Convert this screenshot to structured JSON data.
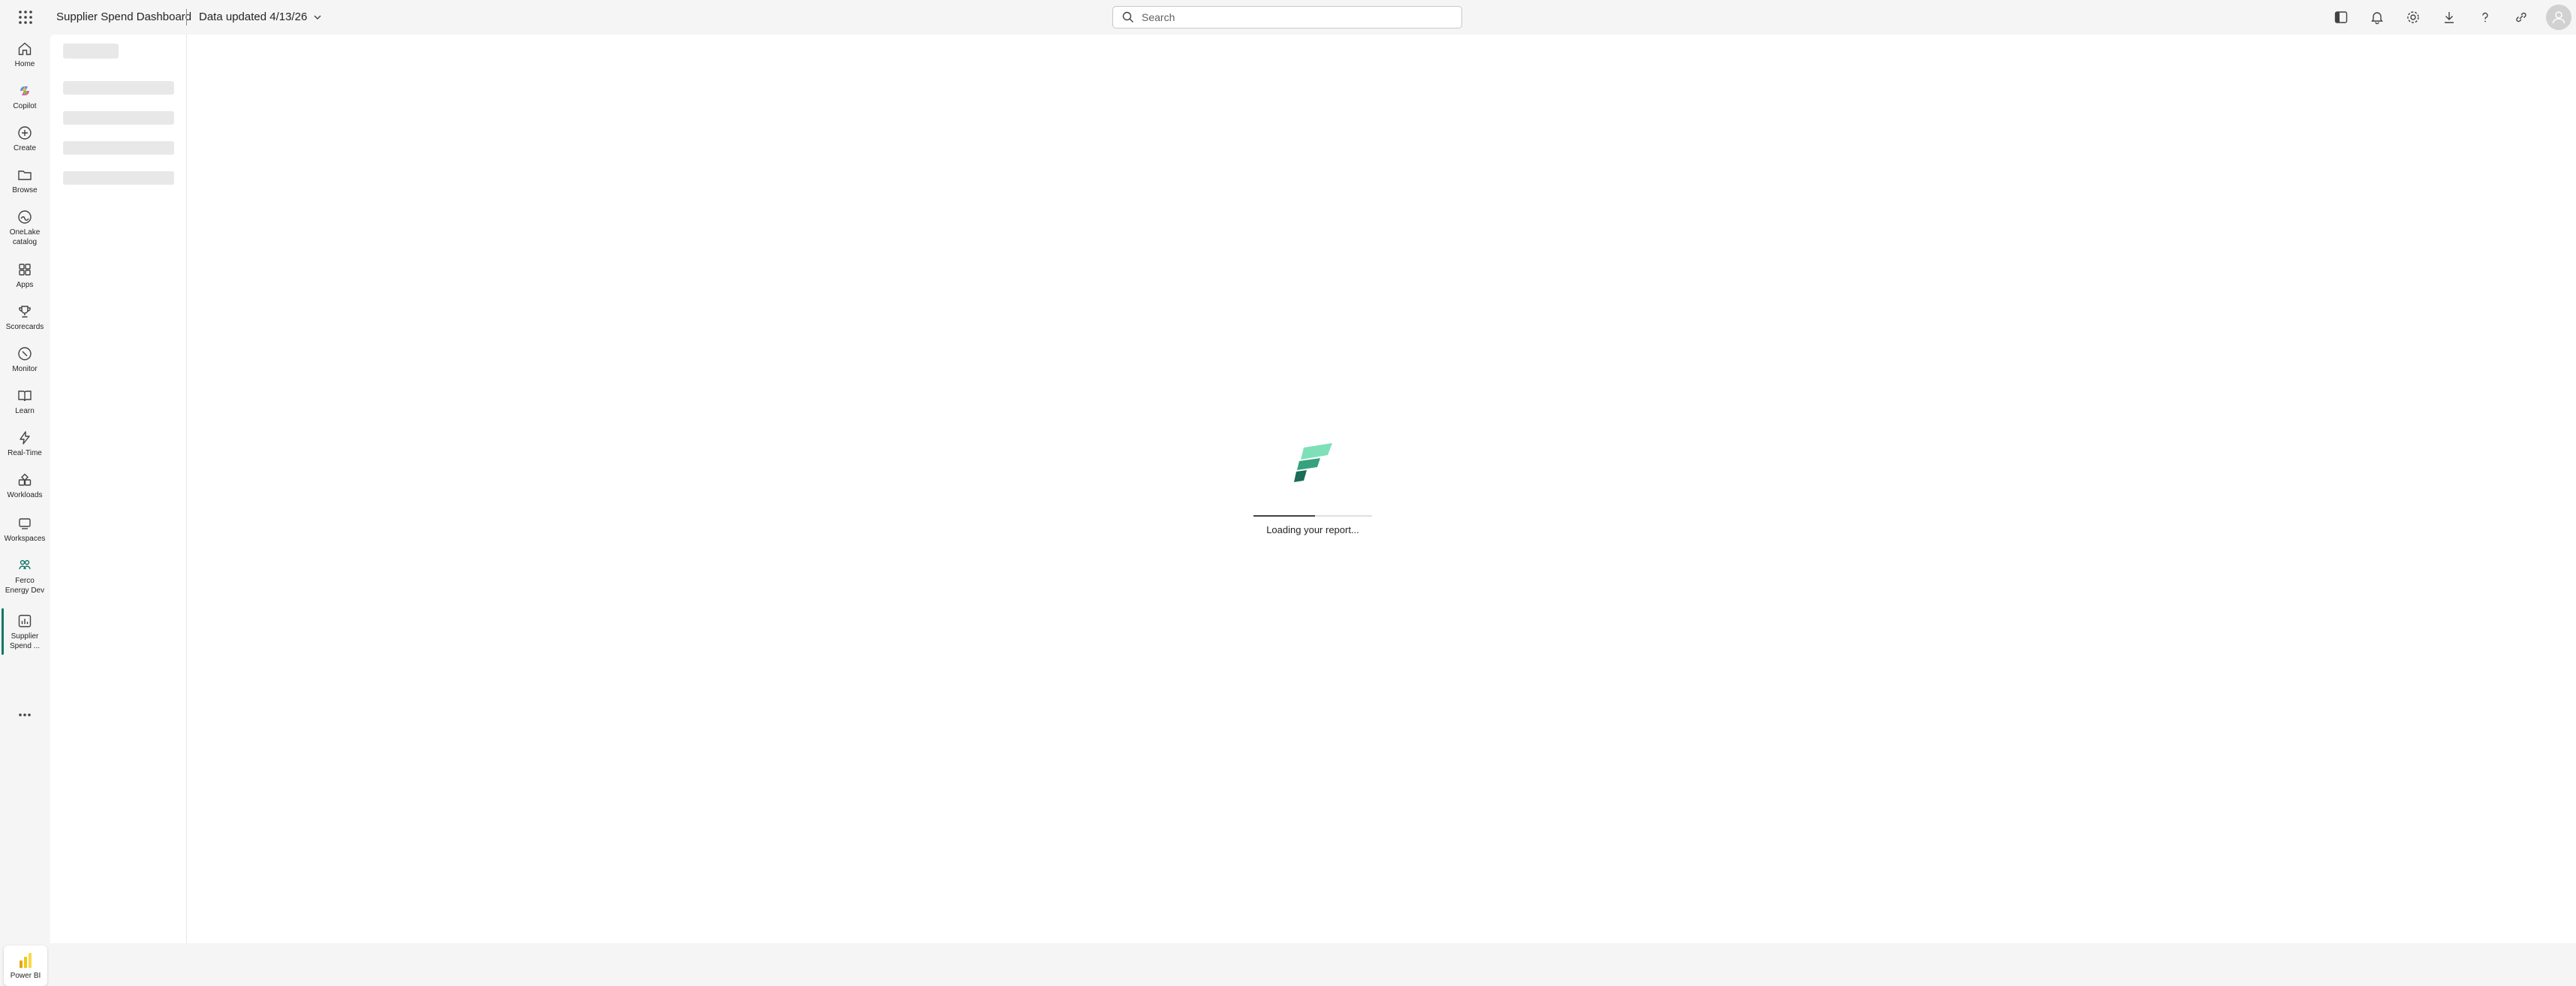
{
  "header": {
    "app_title": "Supplier Spend Dashboard",
    "data_updated": "Data updated 4/13/26",
    "search_placeholder": "Search"
  },
  "header_icons": [
    "panel-toggle-icon",
    "bell-icon",
    "gear-icon",
    "download-icon",
    "help-icon",
    "share-icon",
    "avatar-icon"
  ],
  "nav": {
    "home": "Home",
    "copilot": "Copilot",
    "create": "Create",
    "browse": "Browse",
    "onelake": "OneLake\ncatalog",
    "apps": "Apps",
    "scorecards": "Scorecards",
    "monitor": "Monitor",
    "learn": "Learn",
    "realtime": "Real-Time",
    "workloads": "Workloads",
    "workspaces": "Workspaces",
    "workspace_item": "Ferco\nEnergy Dev",
    "report_item": "Supplier\nSpend ...",
    "active_item": "report_item"
  },
  "switcher": {
    "label": "Power BI"
  },
  "loading": {
    "text": "Loading your report...",
    "progress_fraction": 0.52
  },
  "colors": {
    "accent": "#117865",
    "logo_green_light": "#7ee0b8",
    "logo_green_dark": "#1a6b57",
    "powerbi_yellow": "#f2c811"
  }
}
